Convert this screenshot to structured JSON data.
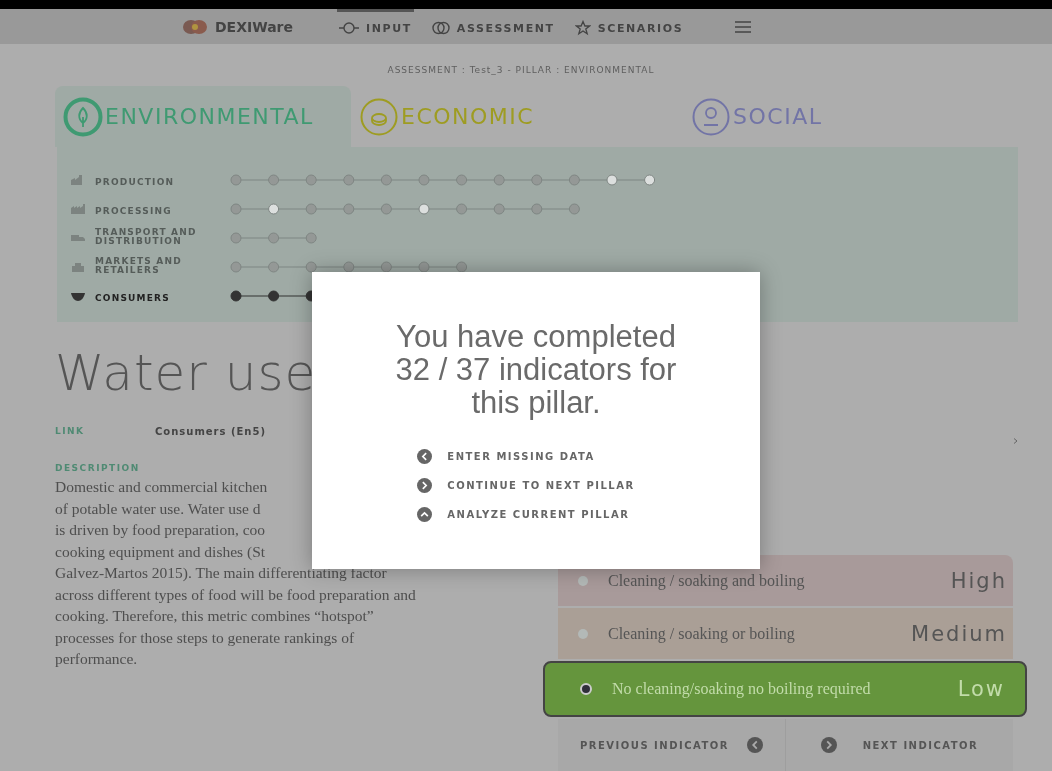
{
  "header": {
    "logo": "DEXIWare",
    "nav": [
      {
        "label": "INPUT",
        "selected": true
      },
      {
        "label": "ASSESSMENT",
        "selected": false
      },
      {
        "label": "SCENARIOS",
        "selected": false
      }
    ]
  },
  "breadcrumb": "ASSESSMENT : Test_3 - PILLAR : ENVIRONMENTAL",
  "pillars": [
    {
      "label": "ENVIRONMENTAL",
      "color": "#3f9a72",
      "selected": true
    },
    {
      "label": "ECONOMIC",
      "color": "#9e9c22",
      "selected": false
    },
    {
      "label": "SOCIAL",
      "color": "#7274a6",
      "selected": false
    }
  ],
  "stages": [
    {
      "label": "PRODUCTION",
      "current": false,
      "steps": [
        true,
        true,
        true,
        true,
        true,
        true,
        true,
        true,
        true,
        true,
        false,
        false
      ]
    },
    {
      "label": "PROCESSING",
      "current": false,
      "steps": [
        true,
        false,
        true,
        true,
        true,
        false,
        true,
        true,
        true,
        true
      ]
    },
    {
      "label": "TRANSPORT AND DISTRIBUTION",
      "current": false,
      "steps": [
        true,
        true,
        true
      ]
    },
    {
      "label": "MARKETS AND RETAILERS",
      "current": false,
      "steps": [
        true,
        true,
        true,
        true,
        true,
        true,
        true
      ]
    },
    {
      "label": "CONSUMERS",
      "current": true,
      "steps": [
        true,
        true,
        true
      ]
    }
  ],
  "indicator": {
    "title": "Water use",
    "link_label": "LINK",
    "link_value": "Consumers (En5)",
    "description_label": "DESCRIPTION",
    "description_lines": [
      "Domestic and commercial kitchen",
      "of potable water use. Water use d",
      "is driven by food preparation, coo",
      "cooking equipment and dishes (St",
      "Galvez-Martos 2015). The main differentiating factor",
      "across different types of food will be food preparation and",
      "cooking. Therefore, this metric combines “hotspot”",
      "processes for those steps to generate rankings of",
      "performance."
    ]
  },
  "answers": [
    {
      "text": "Cleaning / soaking and boiling",
      "level_label": "High",
      "color": "#a89a9a",
      "selected": false
    },
    {
      "text": "Cleaning / soaking or boiling",
      "level_label": "Medium",
      "color": "#aa9f96",
      "selected": false
    },
    {
      "text": "No cleaning/soaking no boiling required",
      "level_label": "Low",
      "color": "#65953d",
      "selected": true
    }
  ],
  "pager": {
    "previous": "PREVIOUS INDICATOR",
    "next": "NEXT INDICATOR"
  },
  "modal": {
    "message": "You have completed 32 / 37 indicators for this pillar.",
    "actions": [
      "ENTER MISSING DATA",
      "CONTINUE TO NEXT PILLAR",
      "ANALYZE CURRENT PILLAR"
    ]
  }
}
